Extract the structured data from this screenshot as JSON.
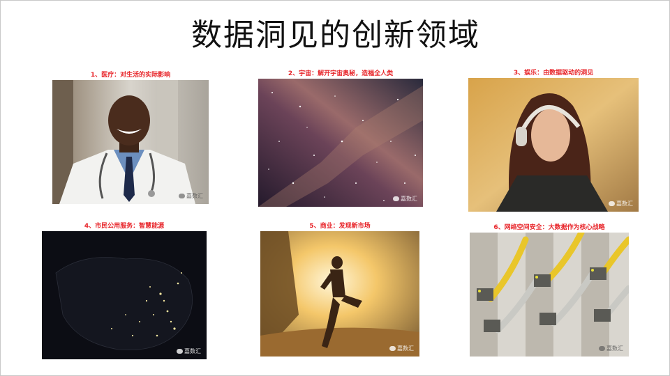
{
  "slide": {
    "title": "数据洞见的创新领域",
    "items": [
      {
        "caption": "1、医疗：对生活的实际影响",
        "watermark": "嘉数汇",
        "image": "doctor-photo"
      },
      {
        "caption": "2、宇宙：解开宇宙奥秘，造福全人类",
        "watermark": "嘉数汇",
        "image": "galaxy-photo"
      },
      {
        "caption": "3、娱乐：由数据驱动的洞见",
        "watermark": "嘉数汇",
        "image": "headphones-woman-photo"
      },
      {
        "caption": "4、市民公用服务：智慧能源",
        "watermark": "嘉数汇",
        "image": "night-map-photo"
      },
      {
        "caption": "5、商业：发现新市场",
        "watermark": "嘉数汇",
        "image": "runner-photo"
      },
      {
        "caption": "6、网络空间安全：大数据作为核心战略",
        "watermark": "嘉数汇",
        "image": "network-cables-photo"
      }
    ]
  }
}
